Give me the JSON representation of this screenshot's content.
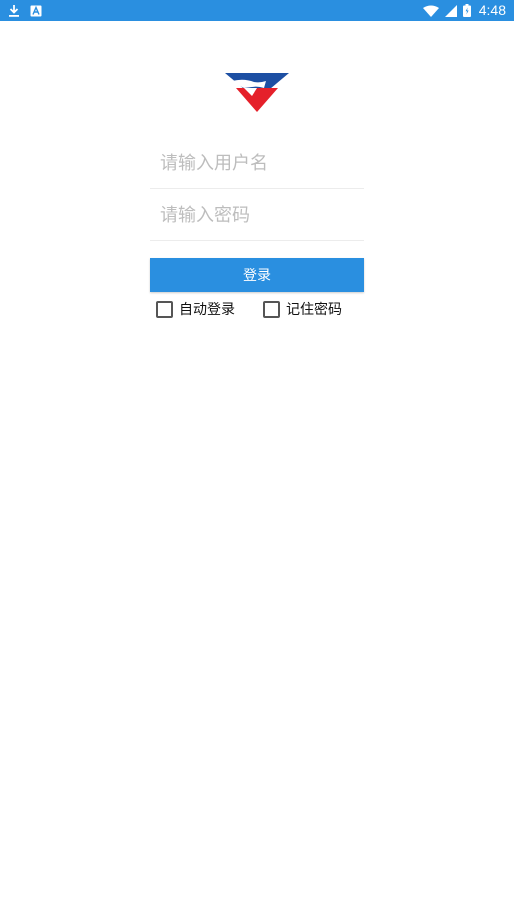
{
  "status_bar": {
    "time": "4:48",
    "icons": [
      "download-icon",
      "notification-a-icon",
      "wifi-icon",
      "signal-icon",
      "battery-icon"
    ],
    "color": "#2a8fe0"
  },
  "logo": {
    "icon": "brand-logo-icon",
    "colors": [
      "#1d4fa3",
      "#e5202a",
      "#ffffff"
    ]
  },
  "form": {
    "username_placeholder": "请输入用户名",
    "password_placeholder": "请输入密码",
    "login_label": "登录",
    "auto_login_label": "自动登录",
    "remember_password_label": "记住密码",
    "auto_login_checked": false,
    "remember_password_checked": false
  },
  "accent_color": "#2a8fe0"
}
